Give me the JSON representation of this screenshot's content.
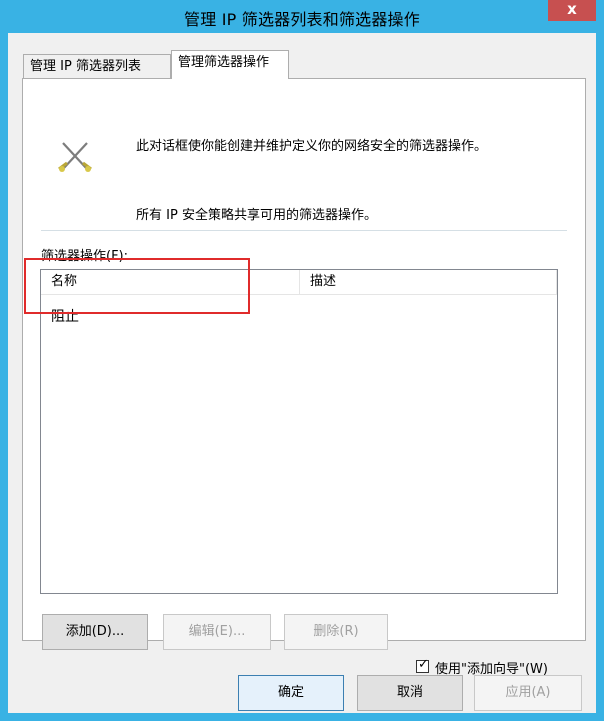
{
  "window": {
    "title": "管理 IP 筛选器列表和筛选器操作",
    "close_label": "x"
  },
  "tabs": [
    {
      "label": "管理 IP 筛选器列表",
      "active": false
    },
    {
      "label": "管理筛选器操作",
      "active": true
    }
  ],
  "description": {
    "icon": "crossed-tools-icon",
    "line1": "此对话框使你能创建并维护定义你的网络安全的筛选器操作。",
    "line2": "所有 IP 安全策略共享可用的筛选器操作。"
  },
  "filter_actions": {
    "label": "筛选器操作(F):",
    "columns": [
      "名称",
      "描述"
    ],
    "rows": [
      {
        "name": "阻止",
        "description": ""
      }
    ]
  },
  "actions": {
    "add": "添加(D)...",
    "edit": "编辑(E)...",
    "delete": "删除(R)",
    "use_wizard_label": "使用\"添加向导\"(W)",
    "use_wizard_checked": true
  },
  "footer": {
    "ok": "确定",
    "cancel": "取消",
    "apply": "应用(A)"
  },
  "colors": {
    "window_frame": "#39b2e4",
    "close_button": "#c75050",
    "annotation": "#e02b2b"
  }
}
